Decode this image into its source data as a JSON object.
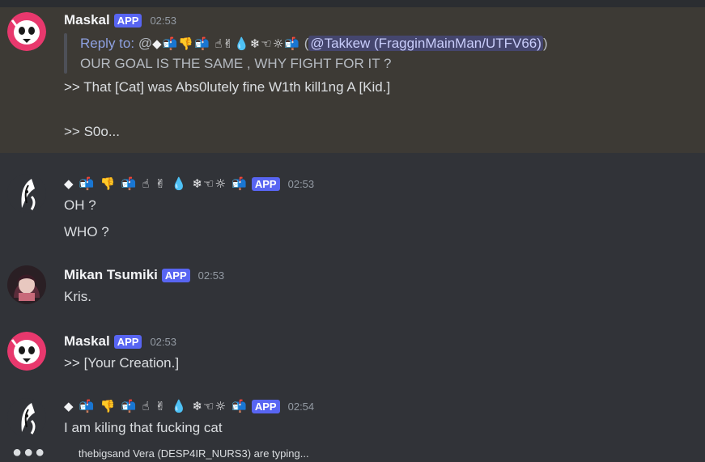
{
  "messages": [
    {
      "username": "Maskal",
      "badge": "APP",
      "time": "02:53",
      "reply": {
        "label": "Reply to:",
        "at": "@",
        "name": "◆📬👎📬 ☝✌💧❄☜☼📬",
        "mention": "@Takkew (FragginMainMan/UTFV66)",
        "text": "OUR GOAL IS THE SAME , WHY FIGHT FOR IT ?"
      },
      "lines": [
        "&gt;&gt; That [Cat] was Abs0lutely fine W1th kill1ng A [Kid.]",
        "",
        "&gt;&gt; S0o..."
      ]
    },
    {
      "username": "◆ 📬 👎 📬 ☝ ✌ 💧 ❄☜☼ 📬",
      "badge": "APP",
      "time": "02:53",
      "lines": [
        "OH ?",
        "WHO ?"
      ]
    },
    {
      "username": "Mikan Tsumiki",
      "badge": "APP",
      "time": "02:53",
      "lines": [
        "Kris."
      ]
    },
    {
      "username": "Maskal",
      "badge": "APP",
      "time": "02:53",
      "lines": [
        "&gt;&gt; [Your Creation.]"
      ]
    },
    {
      "username": "◆ 📬 👎 📬 ☝ ✌ 💧 ❄☜☼ 📬",
      "badge": "APP",
      "time": "02:54",
      "lines": [
        "I am kiling that fucking cat"
      ]
    }
  ],
  "typing": {
    "dots": "●●●",
    "text": "thebigsand Vera (DESP4IR_NURS3) are typing..."
  },
  "colors": {
    "background": "#313338",
    "highlight": "#3d3a35",
    "badge": "#5865f2",
    "maskal_avatar": "#e8386d"
  }
}
